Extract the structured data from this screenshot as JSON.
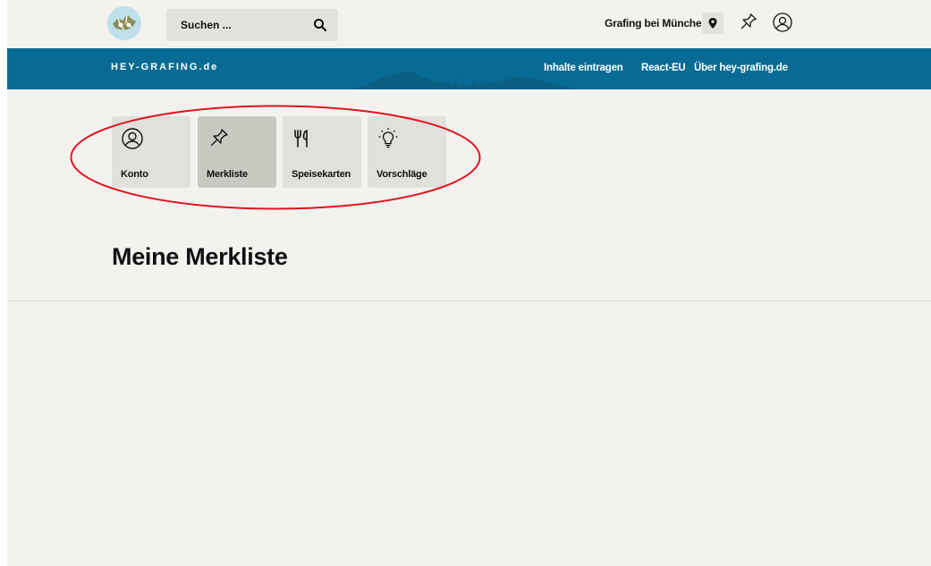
{
  "header": {
    "search": {
      "placeholder": "Suchen ..."
    },
    "location": {
      "label": "Grafing bei München"
    }
  },
  "nav": {
    "brand": "HEY-GRAFING.de",
    "links": [
      {
        "label": "Inhalte eintragen"
      },
      {
        "label": "React-EU"
      },
      {
        "label": "Über hey-grafing.de"
      }
    ]
  },
  "tabs": [
    {
      "label": "Konto",
      "icon": "user-circle-icon",
      "active": false
    },
    {
      "label": "Merkliste",
      "icon": "pushpin-icon",
      "active": true
    },
    {
      "label": "Speisekarten",
      "icon": "fork-knife-icon",
      "active": false
    },
    {
      "label": "Vorschläge",
      "icon": "lightbulb-icon",
      "active": false
    }
  ],
  "main": {
    "title": "Meine Merkliste"
  },
  "colors": {
    "nav_bg": "#076b93",
    "page_bg": "#f3f2ef",
    "tab_bg": "#e1e0db",
    "tab_active_bg": "#c9c8c1",
    "highlight": "#e0141e"
  }
}
